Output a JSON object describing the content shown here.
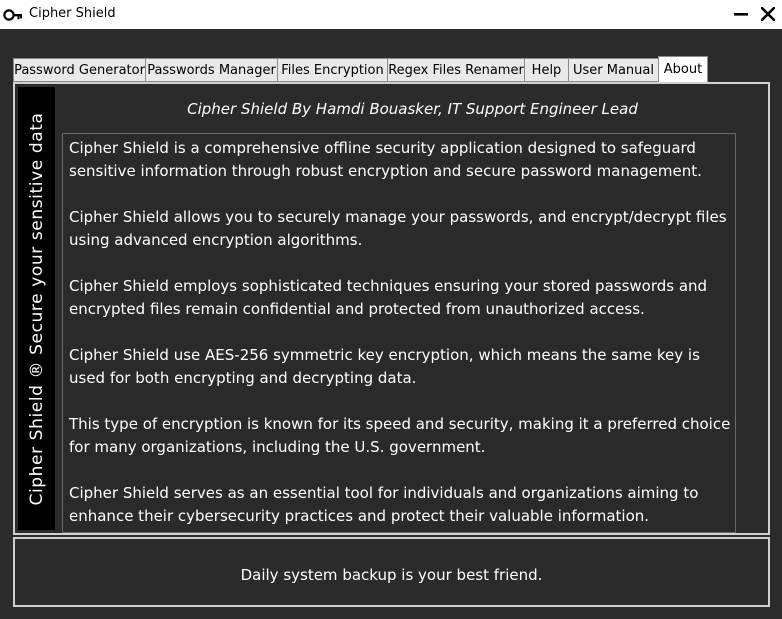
{
  "window": {
    "title": "Cipher Shield",
    "minimize_glyph": "—",
    "close_glyph": "✕"
  },
  "tabs": [
    {
      "label": "Password Generator",
      "active": false
    },
    {
      "label": "Passwords Manager",
      "active": false
    },
    {
      "label": "Files Encryption",
      "active": false
    },
    {
      "label": "Regex Files Renamer",
      "active": false
    },
    {
      "label": "Help",
      "active": false
    },
    {
      "label": "User Manual",
      "active": false
    },
    {
      "label": "About",
      "active": true
    }
  ],
  "sidebar": {
    "text": "Cipher Shield ® Secure your sensitive data"
  },
  "about": {
    "title": "Cipher Shield By Hamdi Bouasker, IT Support Engineer Lead",
    "paragraphs": [
      "Cipher Shield is a comprehensive offline security application designed to safeguard sensitive information through robust encryption and secure password management.",
      "Cipher Shield allows you to securely manage your passwords, and encrypt/decrypt files using advanced encryption algorithms.",
      "Cipher Shield employs sophisticated techniques ensuring your stored passwords and encrypted files remain confidential and protected from unauthorized access.",
      "Cipher Shield use AES-256 symmetric key encryption, which means the same key is used for both encrypting and decrypting data.",
      "This type of encryption is known for its speed and security, making it a preferred choice for many organizations, including the U.S. government.",
      "Cipher Shield serves as an essential tool for individuals and organizations aiming to enhance their cybersecurity practices and protect their valuable information."
    ]
  },
  "footer": {
    "text": "Daily system backup is your best friend."
  },
  "icons": {
    "app": "key-icon",
    "minimize": "minimize-icon",
    "close": "close-icon"
  },
  "colors": {
    "background": "#2b2b2b",
    "sidebar": "#000000",
    "titlebar": "#ffffff",
    "text": "#ffffff"
  }
}
